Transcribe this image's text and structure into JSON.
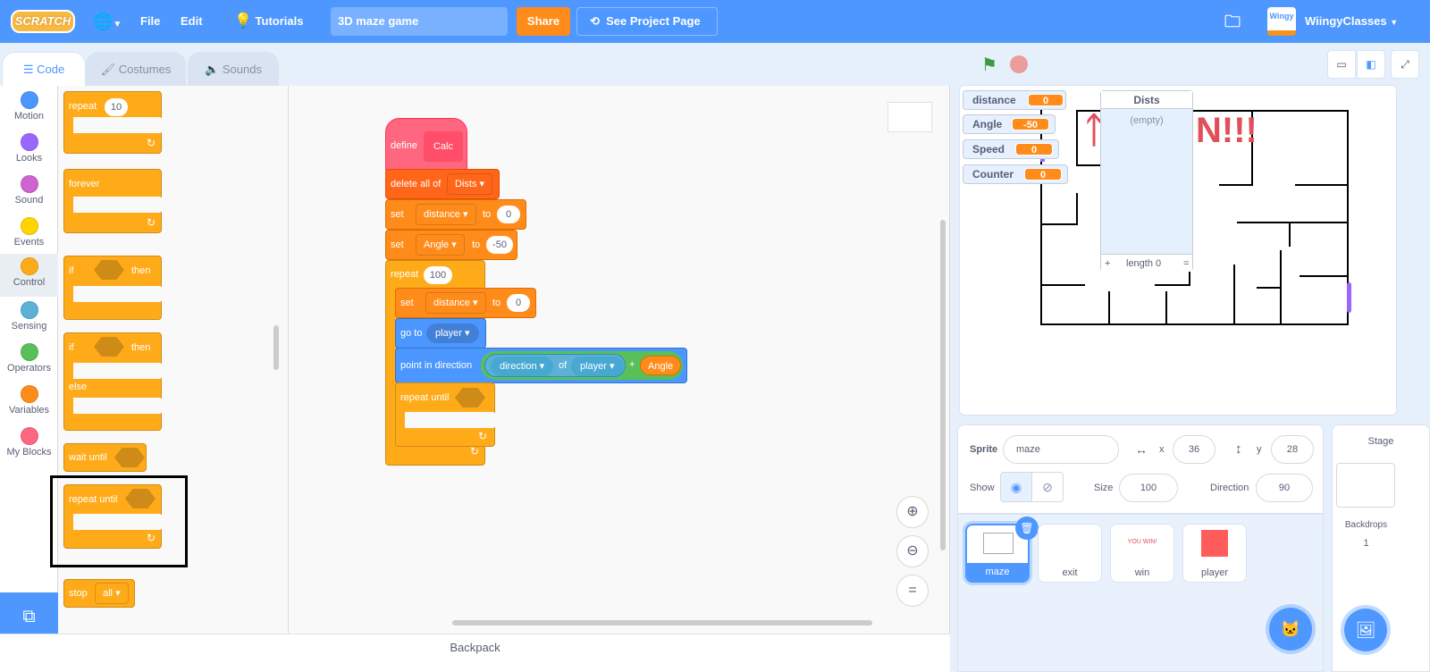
{
  "menubar": {
    "logo": "SCRATCH",
    "language_icon": "globe-icon",
    "file": "File",
    "edit": "Edit",
    "tutorials": "Tutorials",
    "project_title": "3D maze game",
    "share": "Share",
    "see_project_page": "See Project Page",
    "username": "WiingyClasses",
    "avatar_text": "Wingy"
  },
  "tabs": [
    {
      "label": "Code",
      "active": true
    },
    {
      "label": "Costumes",
      "active": false
    },
    {
      "label": "Sounds",
      "active": false
    }
  ],
  "categories": [
    {
      "label": "Motion",
      "color": "#4c97ff"
    },
    {
      "label": "Looks",
      "color": "#9966ff"
    },
    {
      "label": "Sound",
      "color": "#cf63cf"
    },
    {
      "label": "Events",
      "color": "#ffd500"
    },
    {
      "label": "Control",
      "color": "#ffab19",
      "selected": true
    },
    {
      "label": "Sensing",
      "color": "#5cb1d6"
    },
    {
      "label": "Operators",
      "color": "#59c059"
    },
    {
      "label": "Variables",
      "color": "#ff8c1a"
    },
    {
      "label": "My Blocks",
      "color": "#ff6680"
    }
  ],
  "palette": {
    "repeat": "repeat",
    "repeat_count": "10",
    "forever": "forever",
    "if": "if",
    "then": "then",
    "if2": "if",
    "then2": "then",
    "else": "else",
    "wait_until": "wait until",
    "repeat_until": "repeat until",
    "stop": "stop",
    "stop_option": "all"
  },
  "script": {
    "define": "define",
    "define_name": "Calc",
    "delete_all_of": "delete all of",
    "list_name": "Dists",
    "set1": "set",
    "set1_var": "distance",
    "to1": "to",
    "set1_val": "0",
    "set2": "set",
    "set2_var": "Angle",
    "to2": "to",
    "set2_val": "-50",
    "repeat": "repeat",
    "repeat_count": "100",
    "set3": "set",
    "set3_var": "distance",
    "to3": "to",
    "set3_val": "0",
    "go_to": "go to",
    "go_to_target": "player",
    "point_in_direction": "point in direction",
    "sensing_attr": "direction",
    "of": "of",
    "sensing_target": "player",
    "plus": "+",
    "angle_var": "Angle",
    "repeat_until": "repeat until"
  },
  "stage": {
    "monitors": [
      {
        "label": "distance",
        "value": "0"
      },
      {
        "label": "Angle",
        "value": "-50"
      },
      {
        "label": "Speed",
        "value": "0"
      },
      {
        "label": "Counter",
        "value": "0"
      }
    ],
    "list_monitor": {
      "title": "Dists",
      "empty_text": "(empty)",
      "add": "+",
      "length_label": "length 0",
      "resize": "="
    },
    "win_text": "N!!!"
  },
  "sprite_info": {
    "sprite_label": "Sprite",
    "sprite_name": "maze",
    "x_label": "x",
    "x": "36",
    "y_label": "y",
    "y": "28",
    "show_label": "Show",
    "size_label": "Size",
    "size": "100",
    "direction_label": "Direction",
    "direction": "90"
  },
  "sprites": [
    {
      "name": "maze",
      "selected": true
    },
    {
      "name": "exit",
      "selected": false
    },
    {
      "name": "win",
      "selected": false,
      "thumb_text": "YOU WIN!"
    },
    {
      "name": "player",
      "selected": false,
      "thumb_color": "#ff5c5c"
    }
  ],
  "stage_panel": {
    "title": "Stage",
    "backdrops_label": "Backdrops",
    "backdrops_count": "1"
  },
  "backpack": "Backpack"
}
